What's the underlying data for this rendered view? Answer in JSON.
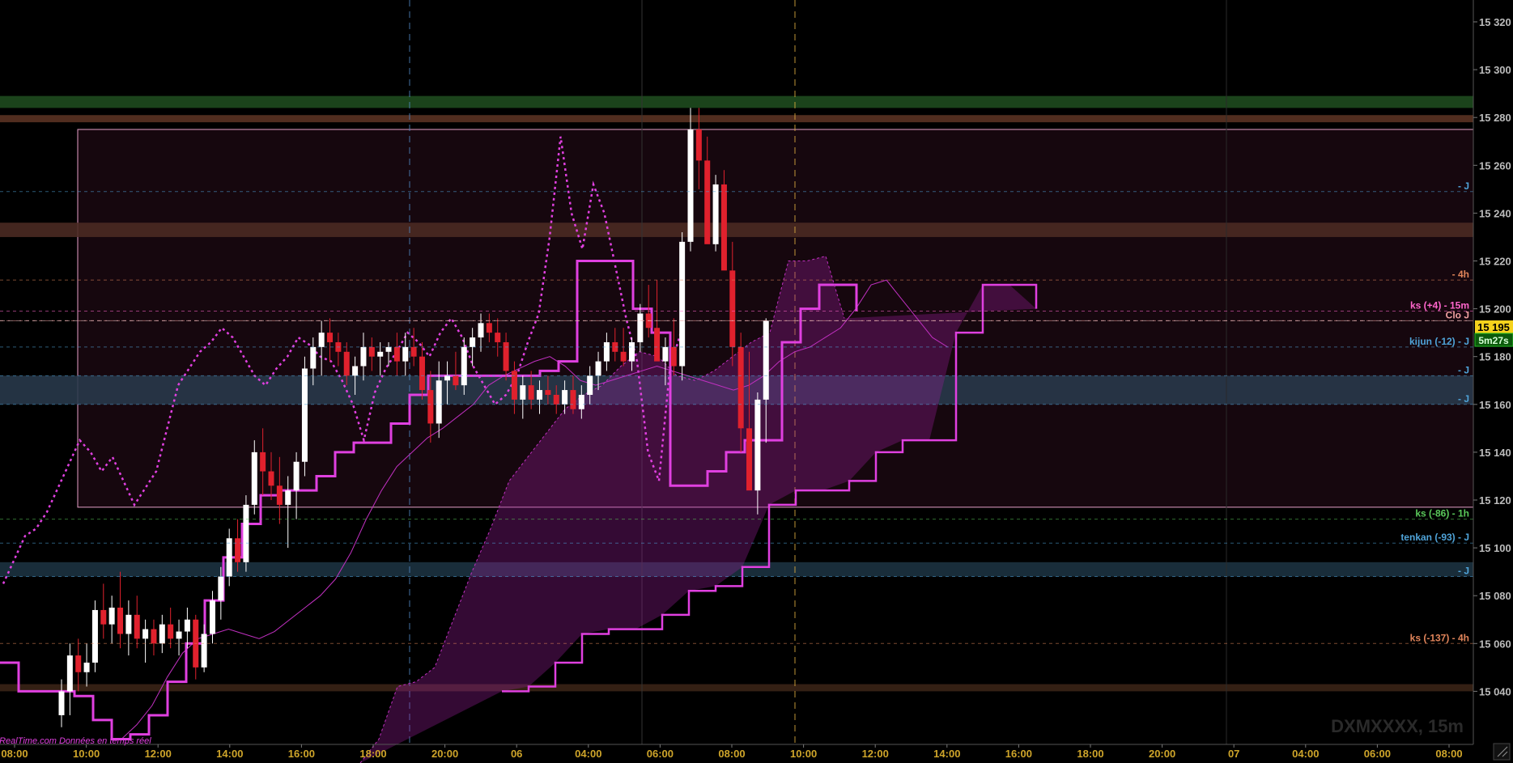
{
  "chart_data": {
    "type": "candlestick",
    "symbol_watermark": "DXMXXXX, 15m",
    "footer_credit": "ProRealTime.com  Données en temps réel",
    "price_axis": {
      "ticks": [
        15320,
        15300,
        15280,
        15260,
        15240,
        15220,
        15200,
        15180,
        15160,
        15140,
        15120,
        15100,
        15080,
        15060,
        15040
      ]
    },
    "time_axis": {
      "labels": [
        "08:00",
        "10:00",
        "12:00",
        "14:00",
        "16:00",
        "18:00",
        "20:00",
        "06",
        "04:00",
        "06:00",
        "08:00",
        "10:00",
        "12:00",
        "14:00",
        "16:00",
        "18:00",
        "20:00",
        "07",
        "04:00",
        "06:00",
        "08:00"
      ]
    },
    "current_price": {
      "label": "15 195",
      "countdown": "5m27s",
      "price": 15195
    },
    "zones": [
      {
        "kind": "band",
        "from": 15284,
        "to": 15289,
        "color": "#1e4a1e"
      },
      {
        "kind": "band",
        "from": 15278,
        "to": 15281,
        "color": "#5a3222"
      },
      {
        "kind": "band",
        "from": 15230,
        "to": 15236,
        "color": "#4a2a22"
      },
      {
        "kind": "band",
        "from": 15160,
        "to": 15172,
        "color": "#28384a"
      },
      {
        "kind": "band",
        "from": 15088,
        "to": 15094,
        "color": "#1c3240"
      },
      {
        "kind": "band",
        "from": 15040,
        "to": 15043,
        "color": "#3a2416"
      }
    ],
    "range_box": {
      "from_price": 15117,
      "to_price": 15275,
      "from_time": "10:00",
      "border_color": "#e6a0c8"
    },
    "levels": [
      {
        "price": 15249,
        "label": "- J",
        "color": "#4fa3d8"
      },
      {
        "price": 15212,
        "label": "- 4h",
        "color": "#e0845a"
      },
      {
        "price": 15199,
        "label": "ks (+4) - 15m",
        "color": "#ff66cc"
      },
      {
        "price": 15195,
        "label": "Clo J",
        "color": "#f0a0a0"
      },
      {
        "price": 15184,
        "label": "kijun (-12) - J",
        "color": "#4fa3d8"
      },
      {
        "price": 15172,
        "label": "- J",
        "color": "#4fa3d8"
      },
      {
        "price": 15160,
        "label": "- J",
        "color": "#4fa3d8"
      },
      {
        "price": 15112,
        "label": "ks (-86) - 1h",
        "color": "#5ac85a"
      },
      {
        "price": 15102,
        "label": "tenkan (-93) - J",
        "color": "#4fa3d8"
      },
      {
        "price": 15088,
        "label": "- J",
        "color": "#4fa3d8"
      },
      {
        "price": 15060,
        "label": "ks (-137) - 4h",
        "color": "#e0845a"
      }
    ],
    "candles": [
      [
        15030,
        15045,
        15025,
        15040
      ],
      [
        15040,
        15060,
        15030,
        15055
      ],
      [
        15055,
        15062,
        15040,
        15048
      ],
      [
        15048,
        15060,
        15042,
        15052
      ],
      [
        15052,
        15078,
        15048,
        15074
      ],
      [
        15074,
        15085,
        15062,
        15068
      ],
      [
        15068,
        15080,
        15060,
        15075
      ],
      [
        15075,
        15090,
        15058,
        15064
      ],
      [
        15064,
        15078,
        15055,
        15072
      ],
      [
        15072,
        15080,
        15058,
        15062
      ],
      [
        15062,
        15070,
        15052,
        15066
      ],
      [
        15066,
        15070,
        15055,
        15060
      ],
      [
        15060,
        15072,
        15056,
        15068
      ],
      [
        15068,
        15075,
        15058,
        15062
      ],
      [
        15062,
        15070,
        15055,
        15065
      ],
      [
        15065,
        15075,
        15058,
        15070
      ],
      [
        15070,
        15072,
        15045,
        15050
      ],
      [
        15050,
        15068,
        15048,
        15064
      ],
      [
        15064,
        15082,
        15060,
        15078
      ],
      [
        15078,
        15092,
        15070,
        15088
      ],
      [
        15088,
        15108,
        15084,
        15104
      ],
      [
        15104,
        15112,
        15090,
        15094
      ],
      [
        15094,
        15122,
        15090,
        15118
      ],
      [
        15118,
        15145,
        15114,
        15140
      ],
      [
        15140,
        15150,
        15122,
        15132
      ],
      [
        15132,
        15140,
        15120,
        15126
      ],
      [
        15126,
        15138,
        15110,
        15118
      ],
      [
        15118,
        15130,
        15100,
        15124
      ],
      [
        15124,
        15140,
        15112,
        15136
      ],
      [
        15136,
        15180,
        15130,
        15175
      ],
      [
        15175,
        15188,
        15168,
        15184
      ],
      [
        15184,
        15195,
        15172,
        15190
      ],
      [
        15190,
        15196,
        15178,
        15186
      ],
      [
        15186,
        15190,
        15176,
        15182
      ],
      [
        15182,
        15186,
        15168,
        15172
      ],
      [
        15172,
        15180,
        15164,
        15176
      ],
      [
        15176,
        15190,
        15170,
        15184
      ],
      [
        15184,
        15188,
        15174,
        15180
      ],
      [
        15180,
        15186,
        15172,
        15182
      ],
      [
        15182,
        15186,
        15176,
        15184
      ],
      [
        15184,
        15190,
        15172,
        15178
      ],
      [
        15178,
        15190,
        15172,
        15184
      ],
      [
        15184,
        15192,
        15176,
        15180
      ],
      [
        15180,
        15186,
        15162,
        15166
      ],
      [
        15166,
        15174,
        15144,
        15152
      ],
      [
        15152,
        15178,
        15146,
        15170
      ],
      [
        15170,
        15178,
        15160,
        15172
      ],
      [
        15172,
        15182,
        15166,
        15168
      ],
      [
        15168,
        15188,
        15164,
        15184
      ],
      [
        15184,
        15192,
        15176,
        15188
      ],
      [
        15188,
        15198,
        15182,
        15194
      ],
      [
        15194,
        15198,
        15186,
        15190
      ],
      [
        15190,
        15196,
        15180,
        15186
      ],
      [
        15186,
        15190,
        15170,
        15174
      ],
      [
        15174,
        15178,
        15156,
        15162
      ],
      [
        15162,
        15172,
        15154,
        15168
      ],
      [
        15168,
        15174,
        15158,
        15162
      ],
      [
        15162,
        15170,
        15156,
        15166
      ],
      [
        15166,
        15172,
        15160,
        15164
      ],
      [
        15164,
        15168,
        15156,
        15160
      ],
      [
        15160,
        15170,
        15156,
        15166
      ],
      [
        15166,
        15172,
        15156,
        15158
      ],
      [
        15158,
        15168,
        15154,
        15164
      ],
      [
        15164,
        15176,
        15160,
        15172
      ],
      [
        15172,
        15182,
        15166,
        15178
      ],
      [
        15178,
        15190,
        15174,
        15186
      ],
      [
        15186,
        15192,
        15178,
        15182
      ],
      [
        15182,
        15192,
        15176,
        15178
      ],
      [
        15178,
        15188,
        15174,
        15186
      ],
      [
        15186,
        15202,
        15182,
        15198
      ],
      [
        15198,
        15210,
        15188,
        15192
      ],
      [
        15192,
        15212,
        15180,
        15178
      ],
      [
        15178,
        15188,
        15168,
        15184
      ],
      [
        15184,
        15196,
        15172,
        15176
      ],
      [
        15176,
        15232,
        15170,
        15228
      ],
      [
        15228,
        15284,
        15224,
        15275
      ],
      [
        15275,
        15284,
        15250,
        15262
      ],
      [
        15262,
        15272,
        15240,
        15227
      ],
      [
        15227,
        15256,
        15224,
        15252
      ],
      [
        15252,
        15258,
        15220,
        15216
      ],
      [
        15216,
        15228,
        15176,
        15184
      ],
      [
        15184,
        15190,
        15140,
        15150
      ],
      [
        15150,
        15182,
        15128,
        15124
      ],
      [
        15124,
        15165,
        15114,
        15162
      ],
      [
        15162,
        15196,
        15144,
        15195
      ]
    ],
    "series": [
      {
        "name": "chikou",
        "style": "dotted",
        "color": "#e040e0",
        "values": [
          15085,
          15095,
          15105,
          15108,
          15115,
          15125,
          15135,
          15145,
          15140,
          15132,
          15138,
          15128,
          15118,
          15125,
          15132,
          15150,
          15168,
          15175,
          15182,
          15186,
          15192,
          15188,
          15180,
          15172,
          15168,
          15175,
          15180,
          15188,
          15185,
          15180,
          15178,
          15170,
          15160,
          15145,
          15165,
          15175,
          15182,
          15190,
          15186,
          15180,
          15190,
          15196,
          15188,
          15176,
          15168,
          15160,
          15164,
          15172,
          15186,
          15198,
          15230,
          15272,
          15240,
          15225,
          15252,
          15240,
          15218,
          15196,
          15178,
          15140,
          15128,
          15175,
          15190
        ]
      },
      {
        "name": "tenkan",
        "style": "solid-thin",
        "color": "#c030c0",
        "values": [
          15020,
          15026,
          15034,
          15046,
          15056,
          15062,
          15064,
          15066,
          15064,
          15062,
          15065,
          15070,
          15075,
          15080,
          15087,
          15098,
          15112,
          15124,
          15134,
          15140,
          15146,
          15150,
          15155,
          15160,
          15168,
          15172,
          15175,
          15178,
          15180,
          15176,
          15170,
          15168,
          15170,
          15172,
          15174,
          15176,
          15174,
          15172,
          15170,
          15168,
          15166,
          15168,
          15172,
          15178,
          15182,
          15184,
          15188,
          15192,
          15200,
          15210,
          15212,
          15204,
          15196,
          15188,
          15184
        ]
      },
      {
        "name": "kijun",
        "style": "solid-thick",
        "color": "#e040e0",
        "values": [
          15052,
          15040,
          15040,
          15040,
          15038,
          15028,
          15020,
          15022,
          15030,
          15044,
          15060,
          15078,
          15096,
          15110,
          15122,
          15124,
          15124,
          15130,
          15140,
          15144,
          15144,
          15152,
          15164,
          15172,
          15172,
          15172,
          15172,
          15172,
          15172,
          15174,
          15178,
          15220,
          15220,
          15220,
          15200,
          15190,
          15126,
          15126,
          15132,
          15140,
          15145,
          15145,
          15186,
          15200,
          15210,
          15210,
          15199
        ]
      },
      {
        "name": "ssb",
        "style": "dashed-thin",
        "color": "#c030c0",
        "values": [
          15010,
          15020,
          15042,
          15044,
          15050,
          15070,
          15090,
          15108,
          15128,
          15138,
          15148,
          15158,
          15164,
          15168,
          15176,
          15182,
          15180,
          15172,
          15170,
          15174,
          15180,
          15186,
          15190,
          15220,
          15220,
          15222,
          15196
        ]
      },
      {
        "name": "ssa",
        "style": "solid",
        "color": "#e040e0",
        "values": [
          15040,
          15042,
          15052,
          15064,
          15066,
          15066,
          15072,
          15082,
          15084,
          15092,
          15118,
          15124,
          15124,
          15128,
          15140,
          15145,
          15145,
          15190,
          15210,
          15210,
          15200
        ]
      }
    ]
  }
}
